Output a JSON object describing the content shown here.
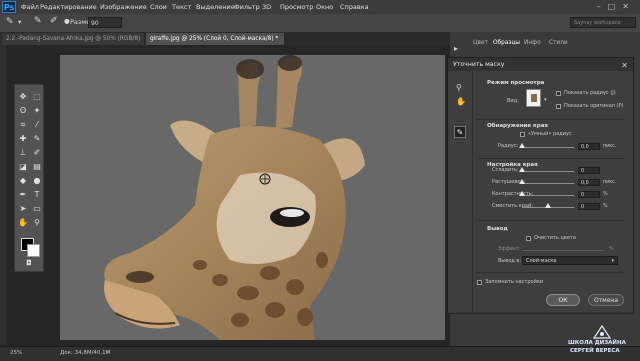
{
  "app": {
    "logo": "Ps"
  },
  "menu": [
    "Файл",
    "Редактирование",
    "Изображение",
    "Слои",
    "Текст",
    "Выделение",
    "Фильтр",
    "3D",
    "Просмотр",
    "Окно",
    "Справка"
  ],
  "options_bar": {
    "size_label": "Размер:",
    "size_value": "90",
    "workspace": "Saynay workspace"
  },
  "tabs": [
    {
      "label": "2.2.-Padang-Savana-Afrika.jpg @ 50% (RGB/8)",
      "active": false
    },
    {
      "label": "giraffe.jpg @ 25% (Слой 0, Слой-маска/8) *",
      "active": true
    }
  ],
  "status": {
    "zoom": "25%",
    "doc": "Док: 34,8M/40,1M"
  },
  "panel_tabs": [
    "Цвет",
    "Образцы",
    "Инфо",
    "Стили"
  ],
  "dialog": {
    "title": "Уточнить маску",
    "view_mode": {
      "heading": "Режим просмотра",
      "view_label": "Вид:",
      "show_radius": "Показать радиус (J)",
      "show_original": "Показать оригинал (P)"
    },
    "edge_detection": {
      "heading": "Обнаружение края",
      "smart_radius": "«Умный» радиус",
      "radius_label": "Радиус:",
      "radius_value": "0,0",
      "radius_unit": "пикс."
    },
    "adjust_edge": {
      "heading": "Настройка края",
      "sliders": [
        {
          "label": "Сгладить:",
          "value": "0",
          "unit": "",
          "position": 0
        },
        {
          "label": "Растушевка:",
          "value": "0,0",
          "unit": "пикс.",
          "position": 0
        },
        {
          "label": "Контрастность:",
          "value": "0",
          "unit": "%",
          "position": 0
        },
        {
          "label": "Сместить край:",
          "value": "0",
          "unit": "%",
          "position": 0.5
        }
      ]
    },
    "output": {
      "heading": "Вывод",
      "decontaminate": "Очистить цвета",
      "amount_label": "Эффект:",
      "amount_unit": "%",
      "output_to_label": "Вывод в:",
      "output_to_value": "Слой-маска"
    },
    "remember": "Запомнить настройки",
    "ok": "ОК",
    "cancel": "Отмена"
  },
  "watermark": {
    "line1": "ШКОЛА ДИЗАЙНА",
    "line2": "СЕРГЕЙ ВЕРЕСА"
  },
  "colors": {
    "canvas": "#686868",
    "accent": "#31a8ff",
    "dialog_bg": "#3e3e3e"
  }
}
